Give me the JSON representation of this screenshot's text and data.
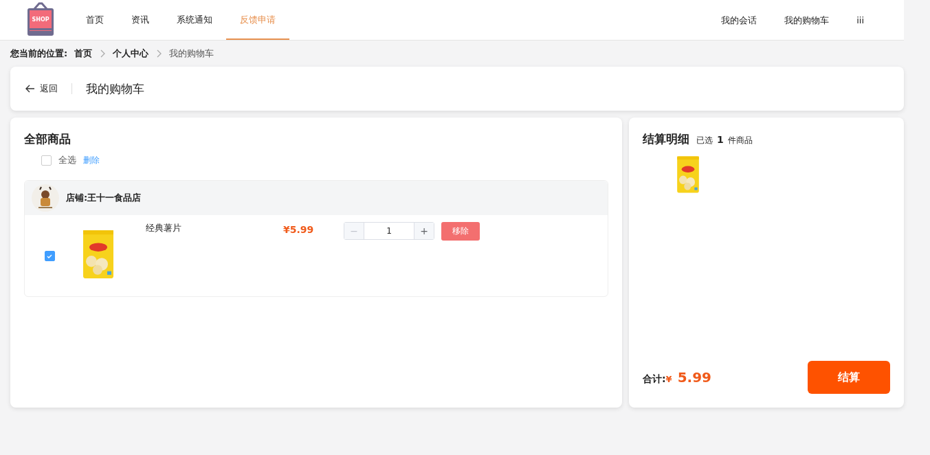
{
  "header": {
    "logo_text": "SHOP",
    "nav": [
      {
        "label": "首页",
        "selected": false
      },
      {
        "label": "资讯",
        "selected": false
      },
      {
        "label": "系统通知",
        "selected": false
      },
      {
        "label": "反馈申请",
        "selected": true
      }
    ],
    "right_links": [
      "我的会话",
      "我的购物车",
      "iii"
    ]
  },
  "breadcrumb": {
    "label": "您当前的位置:",
    "items": [
      {
        "label": "首页",
        "current": false
      },
      {
        "label": "个人中心",
        "current": false
      },
      {
        "label": "我的购物车",
        "current": true
      }
    ]
  },
  "back_bar": {
    "back": "返回",
    "title": "我的购物车"
  },
  "cart": {
    "title": "全部商品",
    "select_all": {
      "label": "全选",
      "checked": false
    },
    "delete": "删除",
    "shops": [
      {
        "name": "店铺:王十一食品店",
        "items": [
          {
            "name": "经典薯片",
            "price": "¥5.99",
            "minus": "−",
            "quantity": "1",
            "plus": "+",
            "remove": "移除",
            "checked": true
          }
        ]
      }
    ]
  },
  "summary": {
    "title": "结算明细",
    "selected_prefix": "已选",
    "selected_count": "1",
    "selected_suffix": "件商品",
    "total_label": "合计:",
    "currency": "¥",
    "total": "5.99",
    "checkout": "结算"
  }
}
